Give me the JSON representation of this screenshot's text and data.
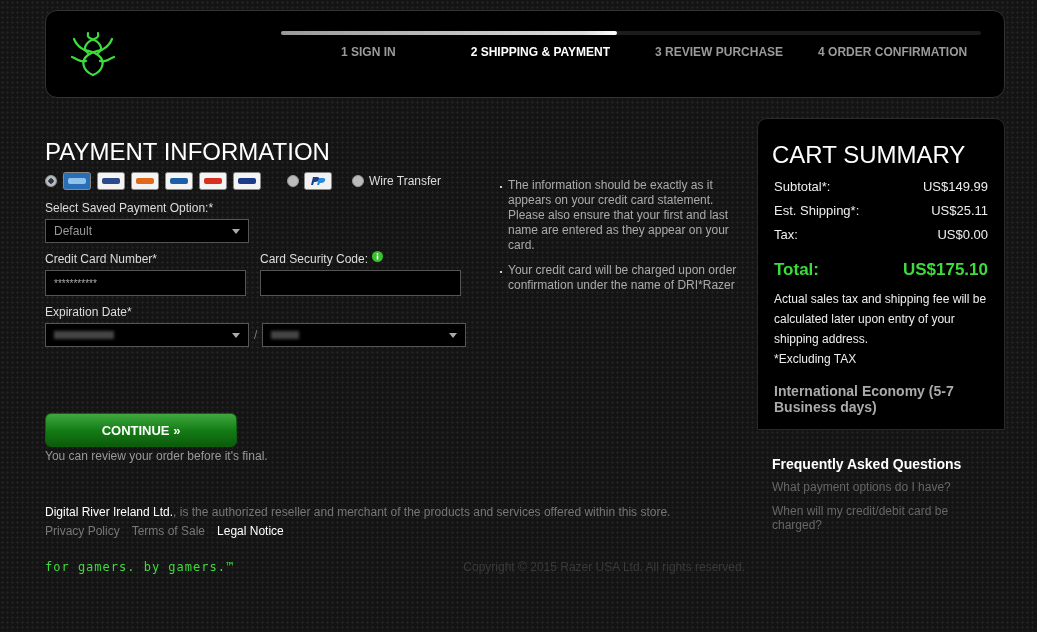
{
  "header": {
    "progress": {
      "level": 0.48
    },
    "steps": [
      {
        "label": "1 SIGN IN",
        "selected": false
      },
      {
        "label": "2 SHIPPING & PAYMENT",
        "selected": true
      },
      {
        "label": "3 REVIEW PURCHASE",
        "selected": false
      },
      {
        "label": "4 ORDER CONFIRMATION",
        "selected": false
      }
    ]
  },
  "payment": {
    "title": "PAYMENT INFORMATION",
    "methods": [
      {
        "kind": "cards",
        "selected": true
      },
      {
        "kind": "paypal",
        "selected": false
      },
      {
        "kind": "wire",
        "label": "Wire Transfer",
        "selected": false
      }
    ],
    "saved_option": {
      "label": "Select Saved Payment Option:*",
      "value": "Default"
    },
    "card_number": {
      "label": "Credit Card Number*",
      "value": "***********"
    },
    "security_code": {
      "label": "Card Security Code:"
    },
    "expiration": {
      "label": "Expiration Date*",
      "separator": "/"
    },
    "notes": [
      "The information should be exactly as it appears on your credit card statement. Please also ensure that your first and last name are entered as they appear on your card.",
      "Your credit card will be charged upon order confirmation under the name of DRI*Razer"
    ],
    "continue_button": "CONTINUE »",
    "review_note": "You can review your order before it's final."
  },
  "footer": {
    "merchant": "Digital River Ireland Ltd.",
    "merchant_text": ", is the authorized reseller and merchant of the products and services offered within this store.",
    "links": [
      {
        "label": "Privacy Policy",
        "active": false
      },
      {
        "label": "Terms of Sale",
        "active": false
      },
      {
        "label": "Legal Notice",
        "active": true
      }
    ],
    "tagline": "for gamers. by gamers.™",
    "copyright": "Copyright © 2015 Razer USA Ltd. All rights reserved."
  },
  "cart": {
    "title": "CART SUMMARY",
    "rows": [
      {
        "kind": "line",
        "label": "Subtotal*:",
        "value": "US$149.99"
      },
      {
        "kind": "line",
        "label": "Est. Shipping*:",
        "value": "US$25.11"
      },
      {
        "kind": "line",
        "label": "Tax:",
        "value": "US$0.00"
      },
      {
        "kind": "total",
        "label": "Total:",
        "value": "US$175.10"
      }
    ],
    "note": "Actual sales tax and shipping fee will be calculated later upon entry of your shipping address.",
    "excluding": "*Excluding TAX",
    "shipping_method": "International Economy (5-7 Business days)"
  },
  "faq": {
    "title": "Frequently Asked Questions",
    "items": [
      "What payment options do I have?",
      "When will my credit/debit card be charged?"
    ]
  }
}
